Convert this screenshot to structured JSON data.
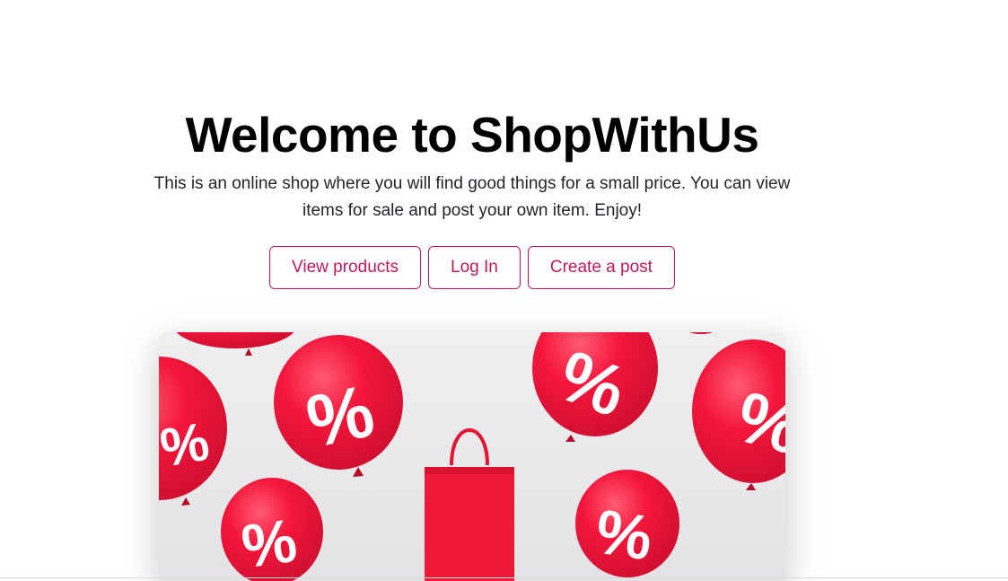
{
  "hero": {
    "title": "Welcome to ShopWithUs",
    "lead": "This is an online shop where you will find good things for a small price. You can view items for sale and post your own item. Enjoy!"
  },
  "actions": {
    "view_products": "View products",
    "log_in": "Log In",
    "create_post": "Create a post"
  },
  "hero_image": {
    "balloon_symbol": "%",
    "balloon_color": "#f4163c",
    "bag_color": "#ef1a38",
    "background_color": "#e9e8ea"
  },
  "colors": {
    "accent": "#c2185b",
    "text": "#000000"
  }
}
